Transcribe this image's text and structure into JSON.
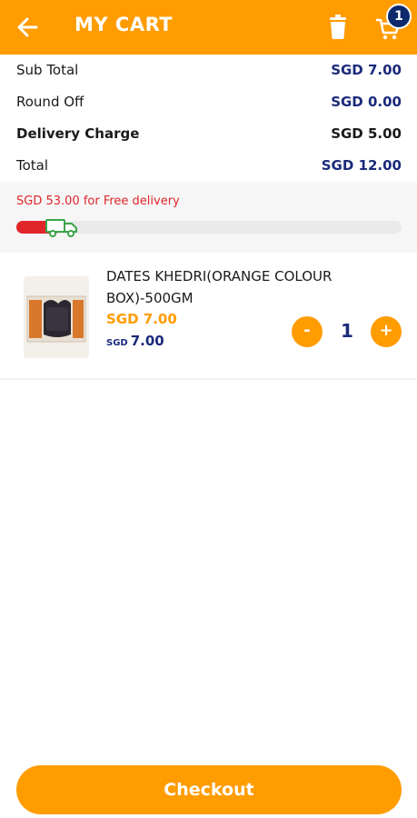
{
  "header": {
    "title": "MY CART",
    "cart_count": "1"
  },
  "summary": [
    {
      "label": "Sub Total",
      "value": "SGD 7.00"
    },
    {
      "label": "Round Off",
      "value": "SGD 0.00"
    },
    {
      "label": "Delivery Charge",
      "value": "SGD 5.00"
    },
    {
      "label": "Total",
      "value": "SGD 12.00"
    }
  ],
  "free_delivery": {
    "message": "SGD 53.00 for Free delivery",
    "progress": 0.1167
  },
  "items": [
    {
      "name": "DATES KHEDRI(ORANGE COLOUR BOX)-500GM",
      "price": "SGD 7.00",
      "original_currency": "SGD",
      "original_amount": "7.00",
      "quantity": "1",
      "minus_label": "-",
      "plus_label": "+"
    }
  ],
  "checkout_label": "Checkout",
  "icons": [
    "back-arrow-icon",
    "trash-icon",
    "cart-icon",
    "delivery-truck-icon",
    "product-image"
  ],
  "colors": {
    "primary": "#ff9c00",
    "navy": "#1b2a7a",
    "badge": "#0e2a6d",
    "alert": "#e0262b"
  }
}
